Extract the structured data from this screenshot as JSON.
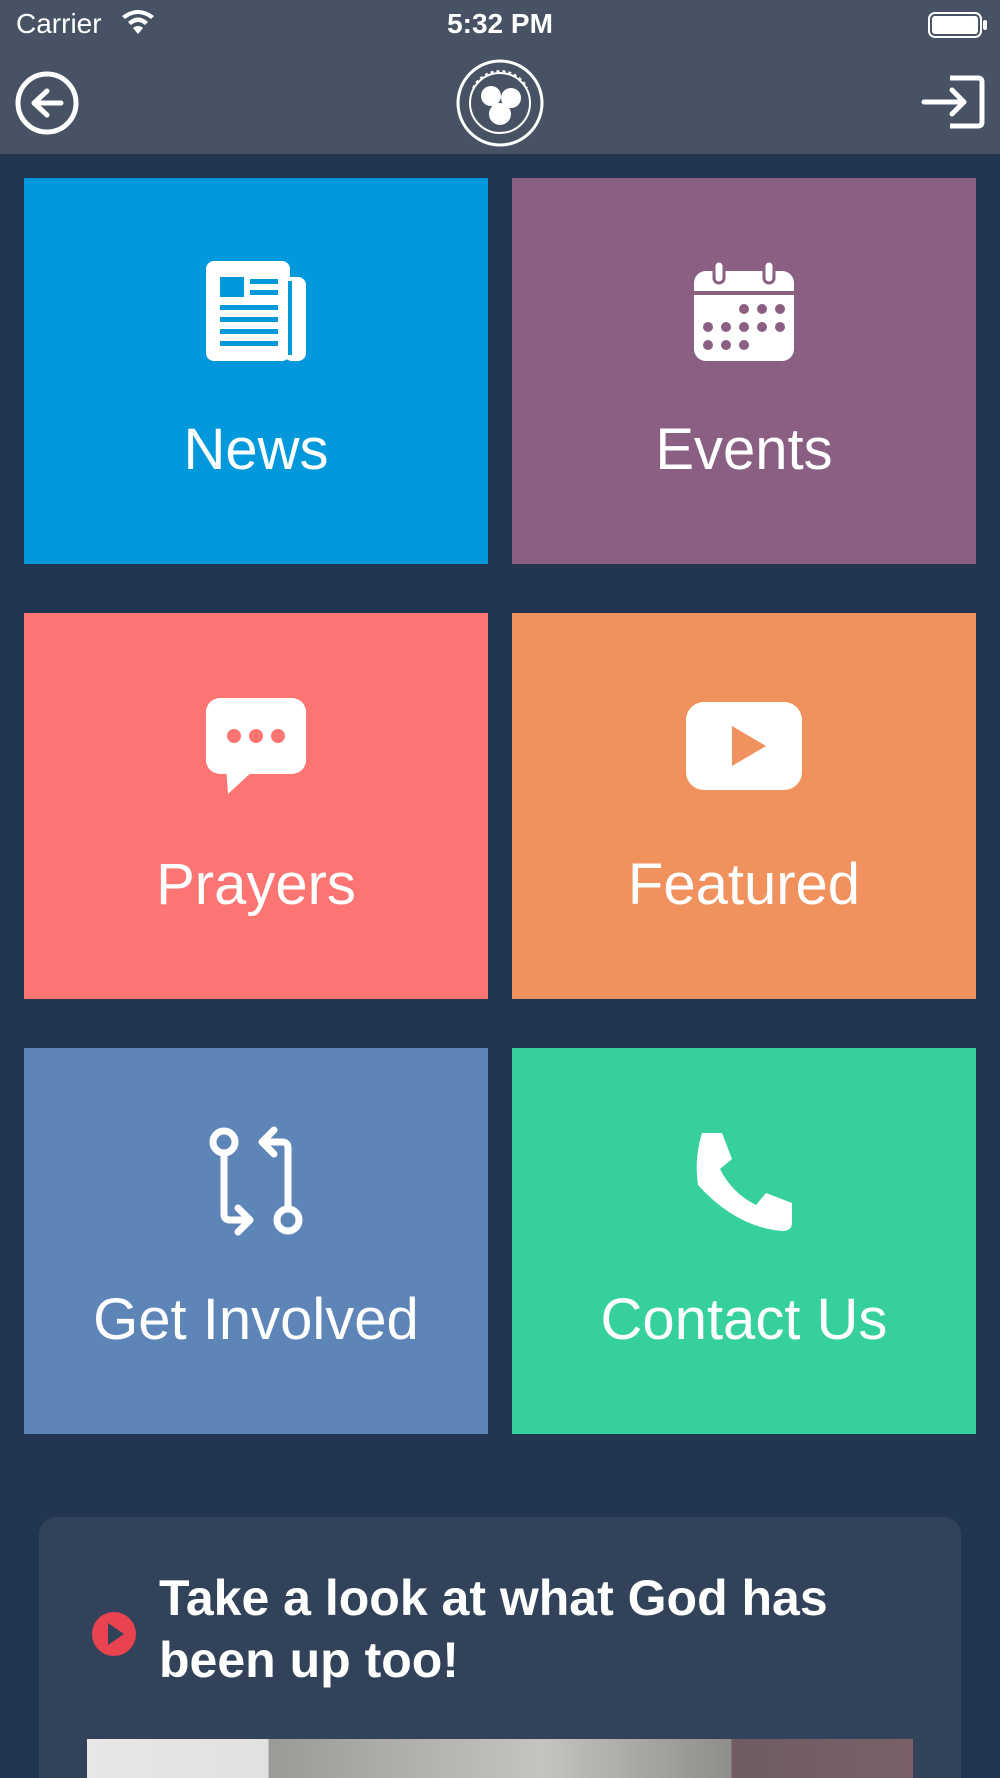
{
  "status_bar": {
    "carrier": "Carrier",
    "time": "5:32 PM"
  },
  "nav": {
    "back_icon": "back-arrow-circle-icon",
    "logo_icon": "church-seal-logo",
    "login_icon": "sign-in-icon",
    "background": "#475364"
  },
  "tiles": [
    {
      "label": "News",
      "icon": "newspaper-icon",
      "color": "#0199dc"
    },
    {
      "label": "Events",
      "icon": "calendar-icon",
      "color": "#8b5f82"
    },
    {
      "label": "Prayers",
      "icon": "chat-bubble-icon",
      "color": "#fd7572"
    },
    {
      "label": "Featured",
      "icon": "play-video-icon",
      "color": "#f0915e"
    },
    {
      "label": "Get Involved",
      "icon": "exchange-arrows-icon",
      "color": "#5e85b7"
    },
    {
      "label": "Contact Us",
      "icon": "phone-icon",
      "color": "#36d09d"
    }
  ],
  "promo": {
    "title": "Take a look at what God has been up too!",
    "icon": "play-circle-icon",
    "accent": "#e8434f"
  },
  "colors": {
    "page_background": "#233651",
    "card_background": "#31425a"
  }
}
